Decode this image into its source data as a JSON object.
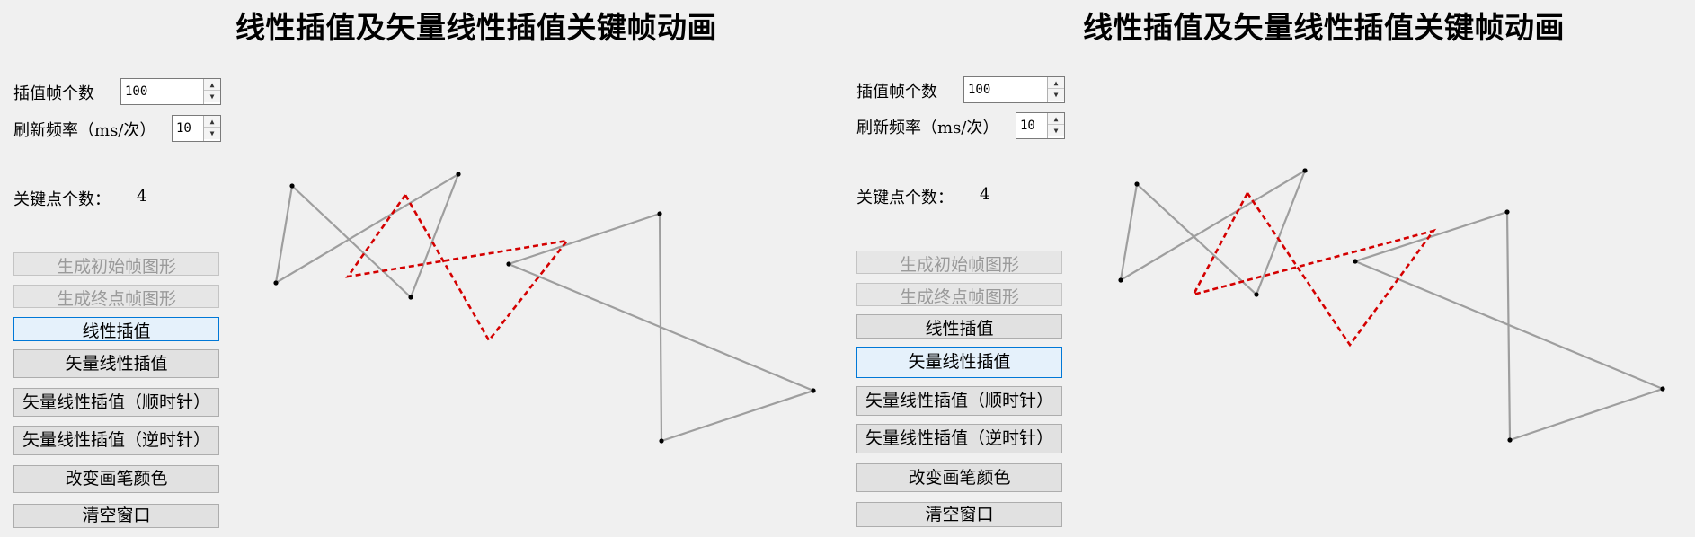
{
  "panels": [
    {
      "title": "线性插值及矢量线性插值关键帧动画",
      "frames_label": "插值帧个数",
      "frames_value": "100",
      "rate_label": "刷新频率（ms/次）",
      "rate_value": "10",
      "keypoints_label": "关键点个数：",
      "keypoints_value": "4",
      "buttons": [
        {
          "label": "生成初始帧图形",
          "state": "disabled"
        },
        {
          "label": "生成终点帧图形",
          "state": "disabled"
        },
        {
          "label": "线性插值",
          "state": "focused"
        },
        {
          "label": "矢量线性插值",
          "state": "normal"
        },
        {
          "label": "矢量线性插值（顺时针）",
          "state": "normal"
        },
        {
          "label": "矢量线性插值（逆时针）",
          "state": "normal"
        },
        {
          "label": "改变画笔颜色",
          "state": "normal"
        },
        {
          "label": "清空窗口",
          "state": "normal"
        }
      ]
    },
    {
      "title": "线性插值及矢量线性插值关键帧动画",
      "frames_label": "插值帧个数",
      "frames_value": "100",
      "rate_label": "刷新频率（ms/次）",
      "rate_value": "10",
      "keypoints_label": "关键点个数：",
      "keypoints_value": "4",
      "buttons": [
        {
          "label": "生成初始帧图形",
          "state": "disabled"
        },
        {
          "label": "生成终点帧图形",
          "state": "disabled"
        },
        {
          "label": "线性插值",
          "state": "normal"
        },
        {
          "label": "矢量线性插值",
          "state": "focused"
        },
        {
          "label": "矢量线性插值（顺时针）",
          "state": "normal"
        },
        {
          "label": "矢量线性插值（逆时针）",
          "state": "normal"
        },
        {
          "label": "改变画笔颜色",
          "state": "normal"
        },
        {
          "label": "清空窗口",
          "state": "normal"
        }
      ]
    }
  ],
  "colors": {
    "shape_outline": "#9e9e9e",
    "interpolated_frame": "#d40000",
    "keypoint": "#000000"
  }
}
